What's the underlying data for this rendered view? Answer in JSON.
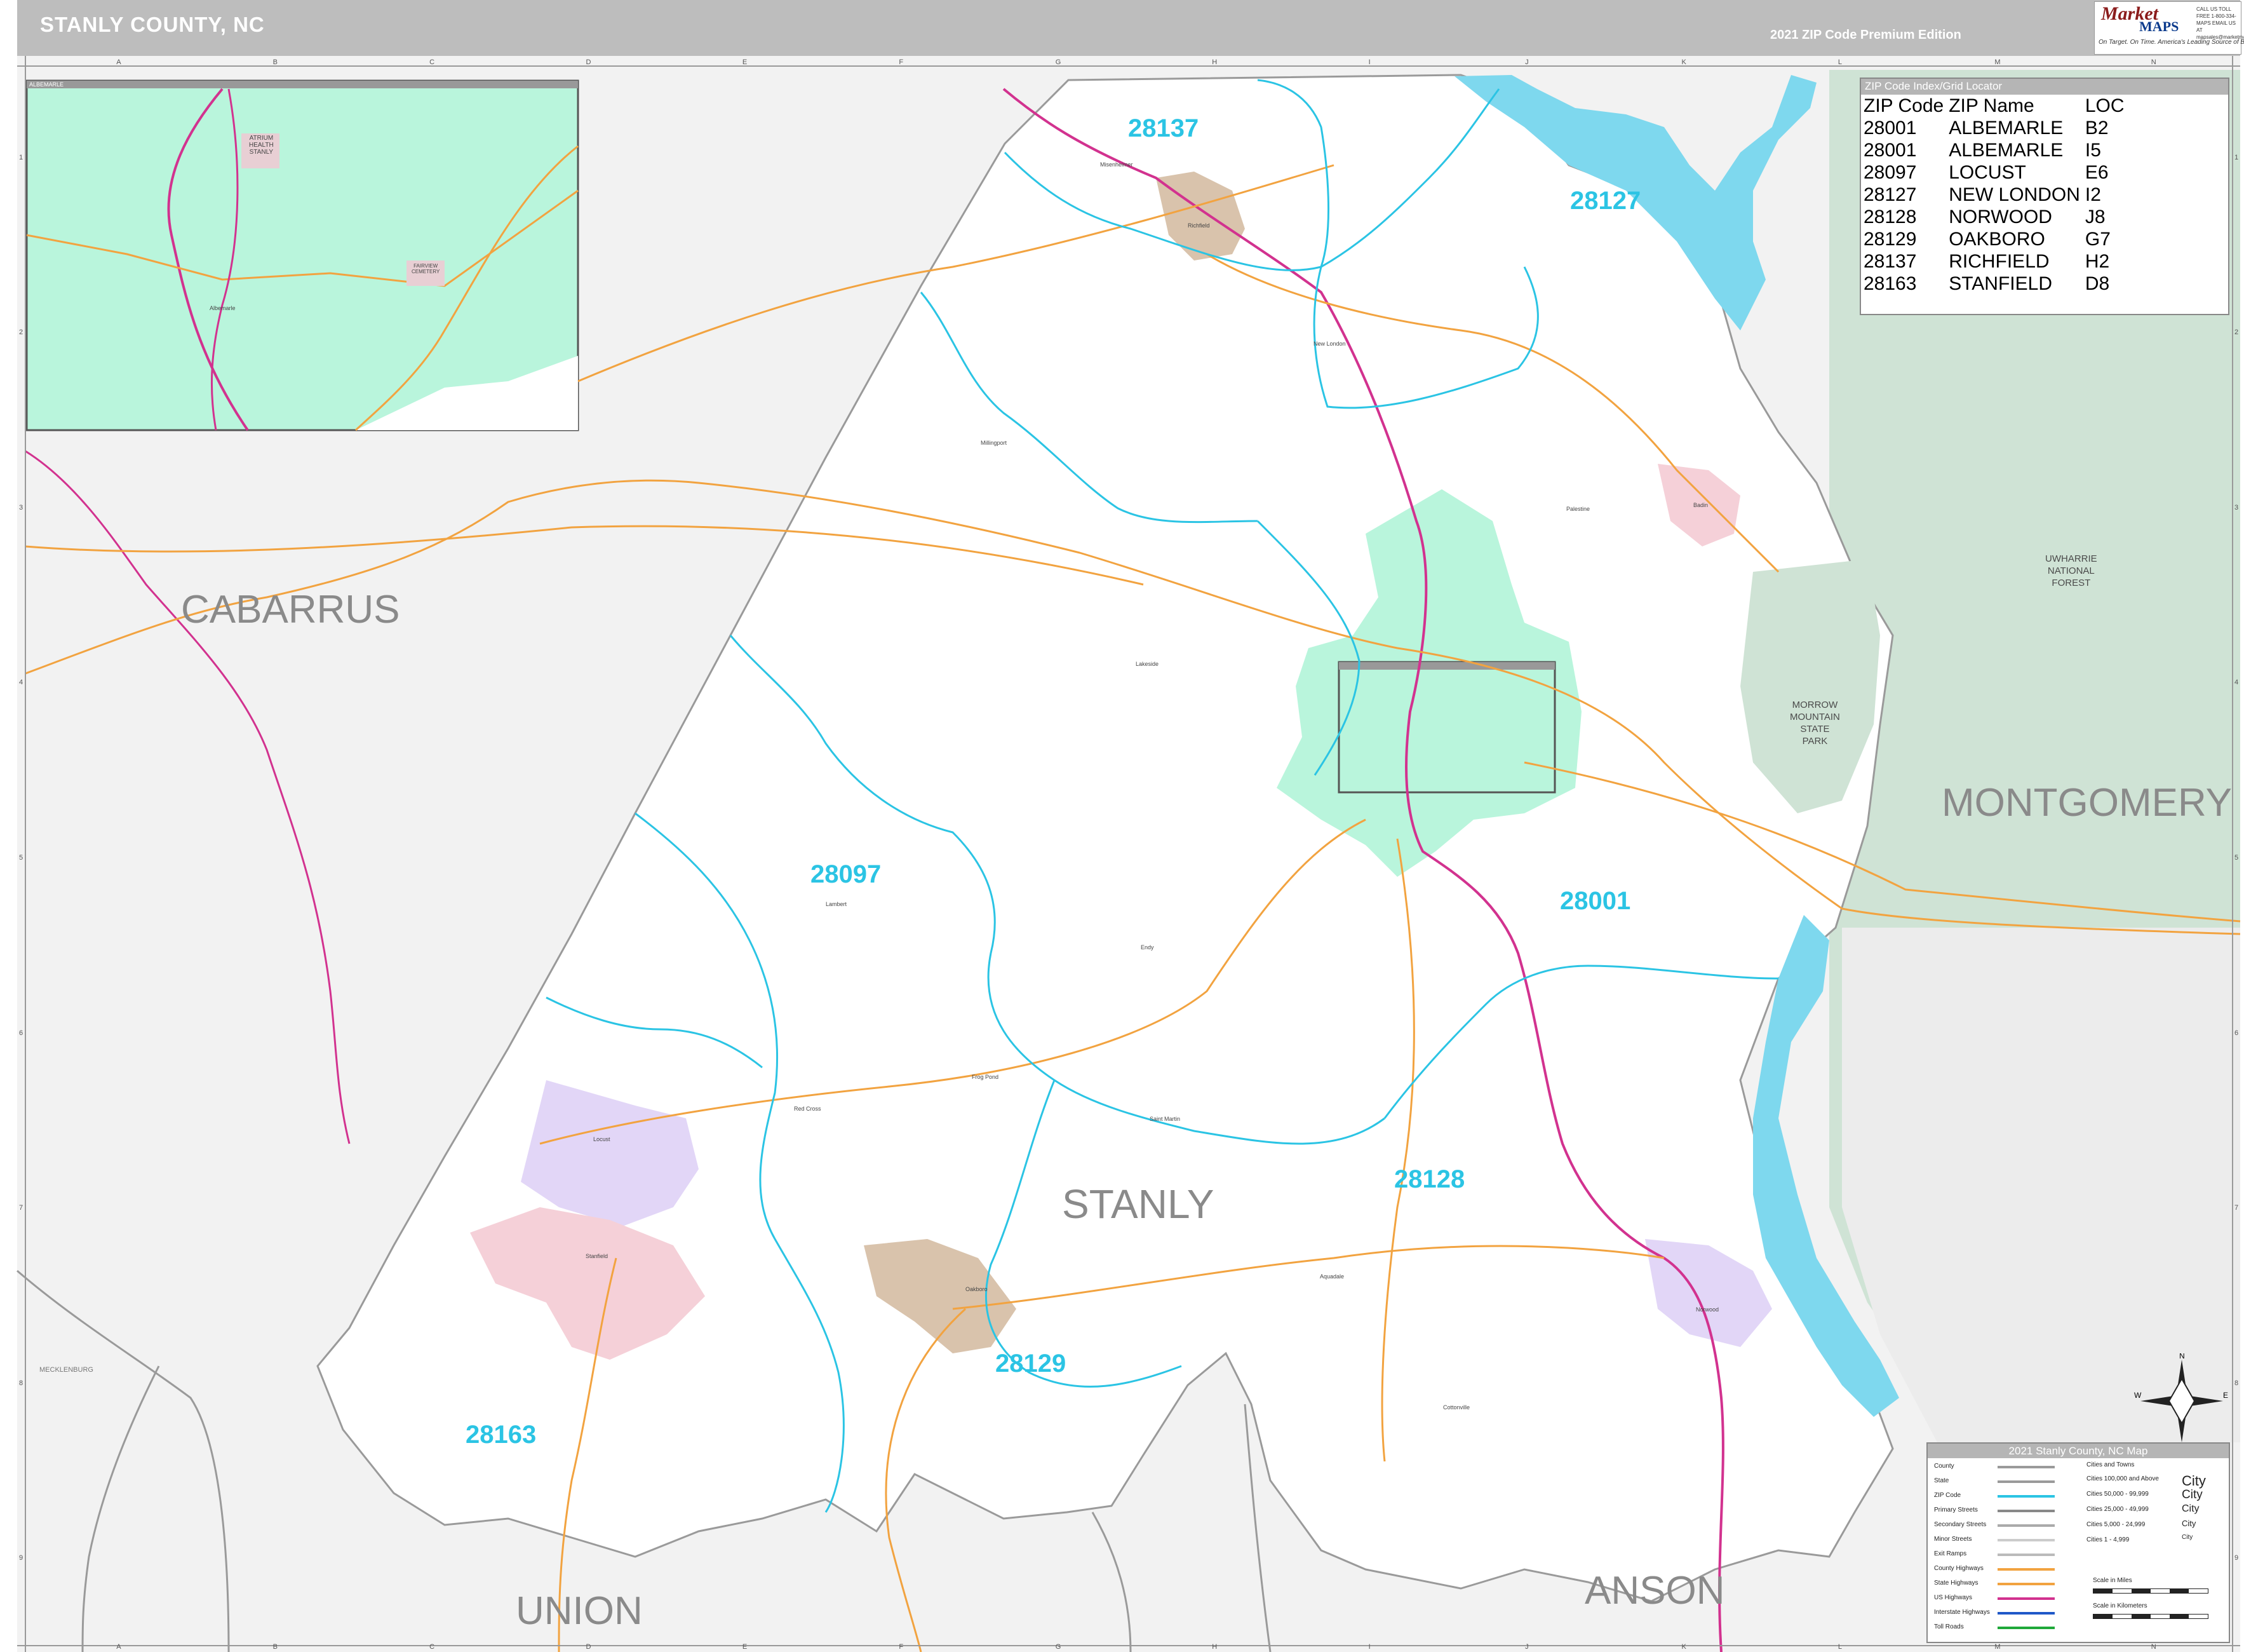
{
  "header": {
    "title": "STANLY COUNTY, NC",
    "edition": "2021 ZIP Code Premium Edition",
    "logo_mark": "Market",
    "logo_maps": "MAPS",
    "logo_tagline": "On Target. On Time. America's Leading Source of Business Maps",
    "logo_contact": "CALL US TOLL FREE 1-800-334-MAPS EMAIL US AT mapsales@marketmaps.com"
  },
  "grid": {
    "columns": [
      "A",
      "B",
      "C",
      "D",
      "E",
      "F",
      "G",
      "H",
      "I",
      "J",
      "K",
      "L",
      "M",
      "N"
    ],
    "rows": [
      "1",
      "2",
      "3",
      "4",
      "5",
      "6",
      "7",
      "8",
      "9"
    ]
  },
  "counties": {
    "cabarrus": "CABARRUS",
    "stanly": "STANLY",
    "montgomery": "MONTGOMERY",
    "union": "UNION",
    "anson": "ANSON",
    "mecklenburg": "MECKLENBURG"
  },
  "zip_labels": {
    "z28137": "28137",
    "z28127": "28127",
    "z28097": "28097",
    "z28001": "28001",
    "z28128": "28128",
    "z28129": "28129",
    "z28163": "28163"
  },
  "parks": {
    "uwharrie": "UWHARRIE\nNATIONAL\nFOREST",
    "morrow": "MORROW\nMOUNTAIN\nSTATE\nPARK"
  },
  "inset": {
    "title": "ALBEMARLE",
    "atrium": "ATRIUM\nHEALTH\nSTANLY",
    "fairview": "FAIRVIEW\nCEMETERY",
    "city": "Albemarle"
  },
  "places": {
    "richfield": "Richfield",
    "misenheimer": "Misenheimer",
    "new_london": "New London",
    "badin": "Badin",
    "locust": "Locust",
    "stanfield": "Stanfield",
    "oakboro": "Oakboro",
    "norwood": "Norwood",
    "aquadale": "Aquadale",
    "cottonville": "Cottonville",
    "lambert": "Lambert",
    "frog_pond": "Frog Pond",
    "red_cross": "Red Cross",
    "saint_martin": "Saint Martin",
    "endy": "Endy",
    "palestine": "Palestine",
    "lakeside": "Lakeside",
    "millingport": "Millingport"
  },
  "zip_index": {
    "title": "ZIP Code Index/Grid Locator",
    "headers": [
      "ZIP Code",
      "ZIP Name",
      "LOC"
    ],
    "rows": [
      [
        "28001",
        "ALBEMARLE",
        "B2"
      ],
      [
        "28001",
        "ALBEMARLE",
        "I5"
      ],
      [
        "28097",
        "LOCUST",
        "E6"
      ],
      [
        "28127",
        "NEW LONDON",
        "I2"
      ],
      [
        "28128",
        "NORWOOD",
        "J8"
      ],
      [
        "28129",
        "OAKBORO",
        "G7"
      ],
      [
        "28137",
        "RICHFIELD",
        "H2"
      ],
      [
        "28163",
        "STANFIELD",
        "D8"
      ]
    ]
  },
  "legend": {
    "title": "2021 Stanly County, NC Map",
    "items": [
      "County",
      "State",
      "ZIP Code",
      "Primary Streets",
      "Secondary Streets",
      "Minor Streets",
      "Exit Ramps",
      "County Highways",
      "State Highways",
      "US Highways",
      "Interstate Highways",
      "Toll Roads"
    ],
    "cities_title": "Cities and Towns",
    "city_classes": [
      "Cities 100,000 and Above",
      "Cities 50,000 - 99,999",
      "Cities 25,000 - 49,999",
      "Cities 5,000 - 24,999",
      "Cities 1 - 4,999"
    ],
    "city_samples": [
      "City",
      "City",
      "City",
      "City",
      "City"
    ],
    "scale_miles": "Scale in Miles",
    "scale_km": "Scale in Kilometers"
  },
  "compass": {
    "n": "N",
    "s": "S",
    "e": "E",
    "w": "W"
  },
  "colors": {
    "county_fill": "#f2f2f2",
    "stanly_fill": "#ffffff",
    "water": "#7ed8ee",
    "park": "#cfe3d5",
    "zip_line": "#2bc4e4",
    "inset_fill": "#b9f5dc",
    "city_pink": "#f5d0d8",
    "city_purple": "#e2d6f7",
    "city_tan": "#d9c3ac",
    "us_highway": "#d2328f",
    "state_highway": "#f2a340"
  }
}
